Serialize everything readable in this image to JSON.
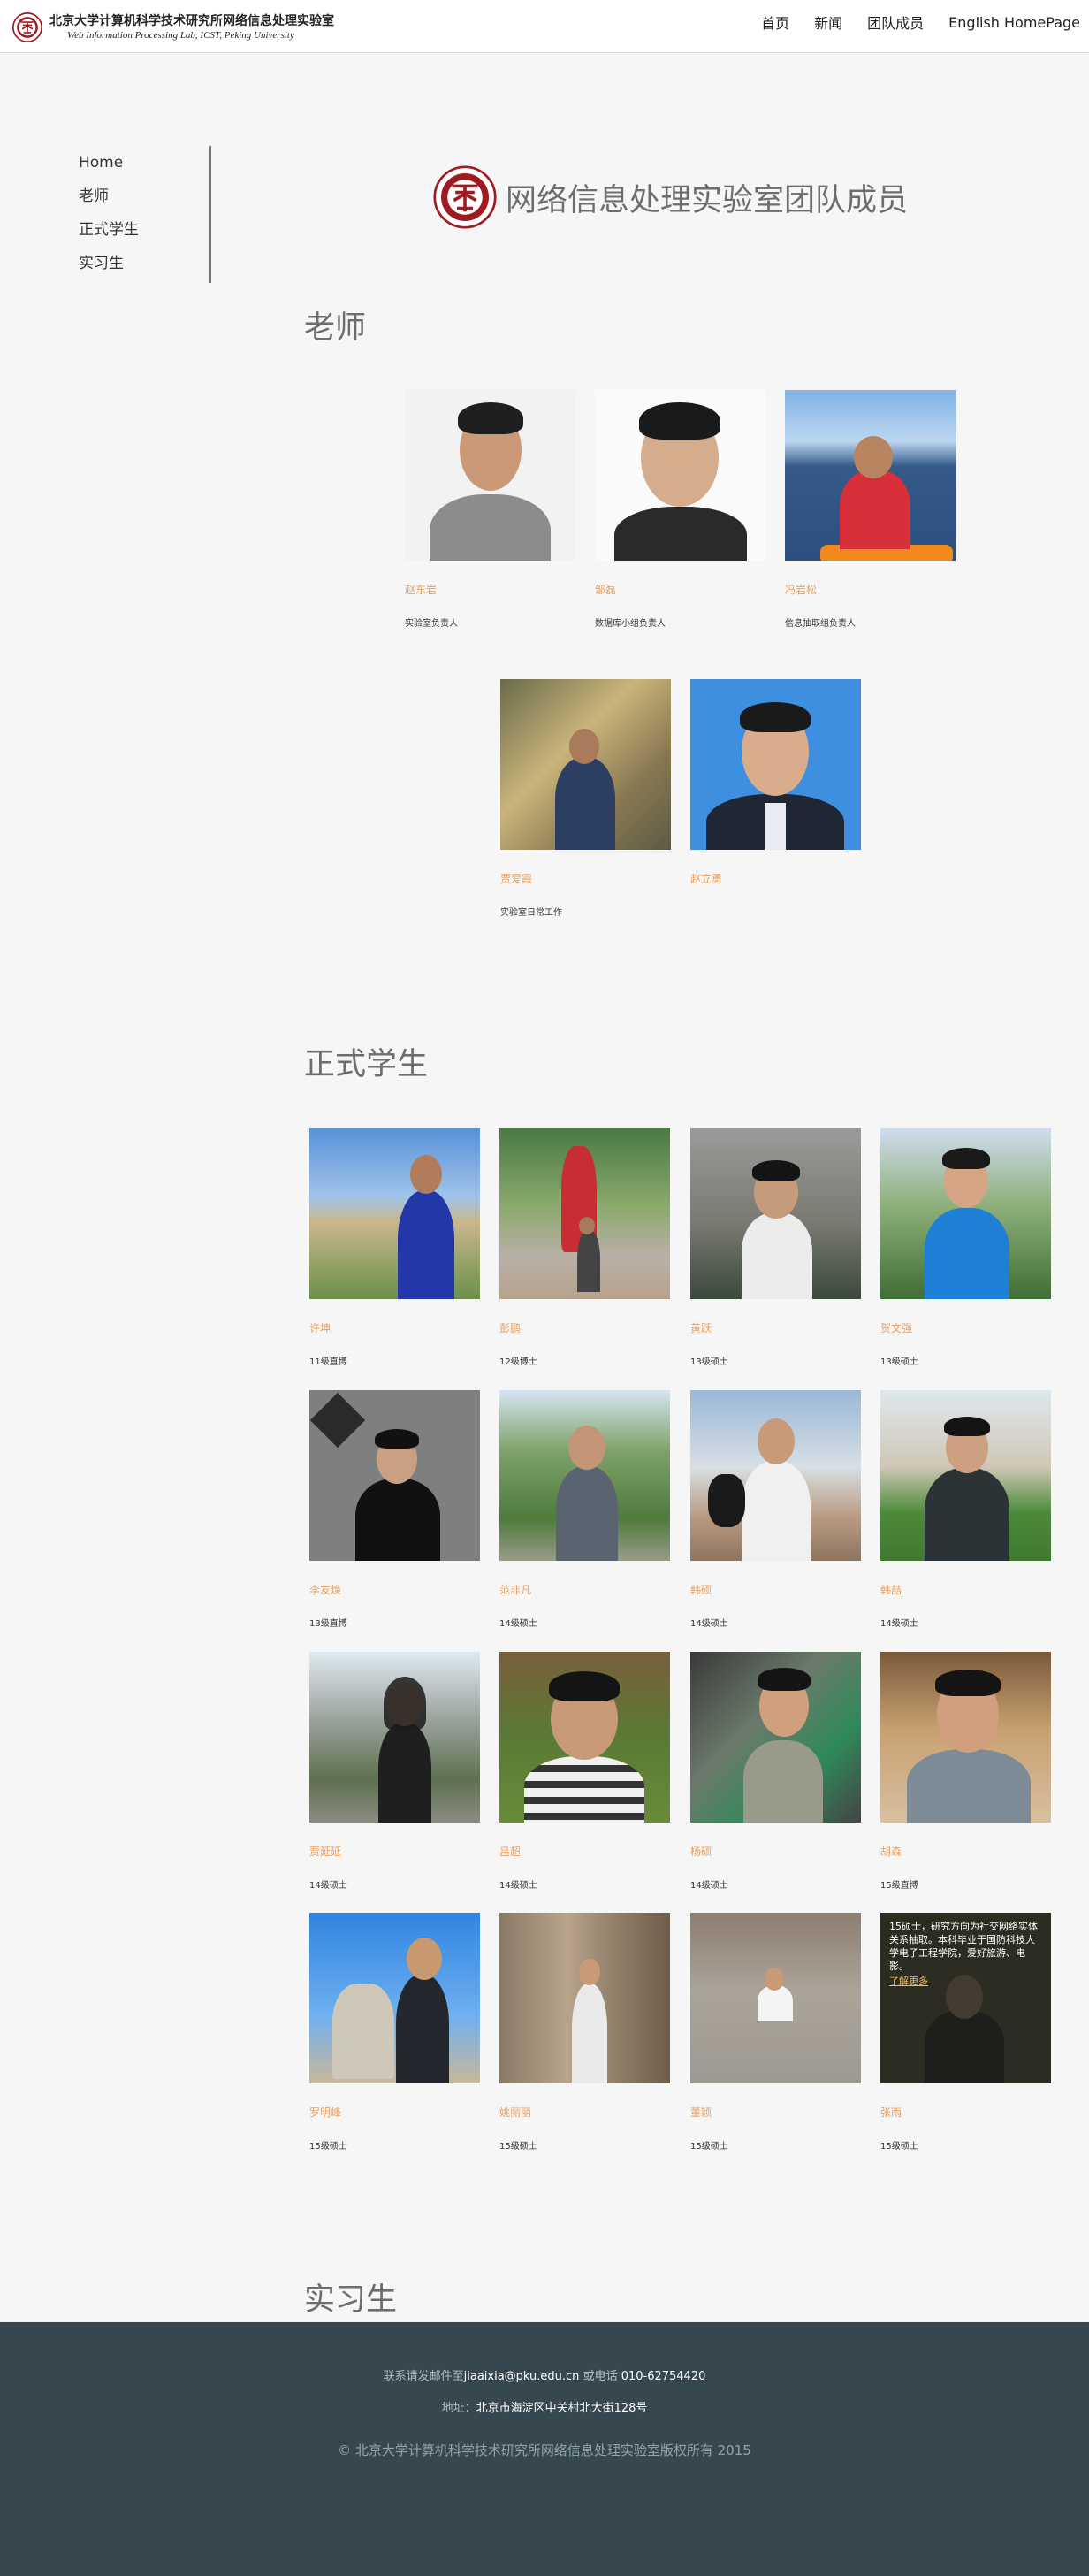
{
  "header": {
    "lab_name_cn": "北京大学计算机科学技术研究所网络信息处理实验室",
    "lab_name_en": "Web Information Processing Lab, ICST, Peking University",
    "logo_icon": "pku-seal-icon"
  },
  "nav": {
    "home": "首页",
    "news": "新闻",
    "team": "团队成员",
    "english": "English HomePage"
  },
  "sidenav": {
    "items": [
      "Home",
      "老师",
      "正式学生",
      "实习生"
    ]
  },
  "page_title": "网络信息处理实验室团队成员",
  "sections": {
    "teachers": "老师",
    "students": "正式学生",
    "interns": "实习生"
  },
  "teachers": [
    {
      "name": "赵东岩",
      "role": "实验室负责人"
    },
    {
      "name": "邹磊",
      "role": "数据库小组负责人"
    },
    {
      "name": "冯岩松",
      "role": "信息抽取组负责人"
    },
    {
      "name": "贾爱霞",
      "role": "实验室日常工作"
    },
    {
      "name": "赵立勇",
      "role": ""
    }
  ],
  "students": [
    {
      "name": "许坤",
      "role": "11级直博"
    },
    {
      "name": "彭鹏",
      "role": "12级博士"
    },
    {
      "name": "黄跃",
      "role": "13级硕士"
    },
    {
      "name": "贺文强",
      "role": "13级硕士"
    },
    {
      "name": "李友焕",
      "role": "13级直博"
    },
    {
      "name": "范非凡",
      "role": "14级硕士"
    },
    {
      "name": "韩硕",
      "role": "14级硕士"
    },
    {
      "name": "韩喆",
      "role": "14级硕士"
    },
    {
      "name": "贾延延",
      "role": "14级硕士"
    },
    {
      "name": "吕超",
      "role": "14级硕士"
    },
    {
      "name": "杨硕",
      "role": "14级硕士"
    },
    {
      "name": "胡森",
      "role": "15级直博"
    },
    {
      "name": "罗明峰",
      "role": "15级硕士"
    },
    {
      "name": "姚丽丽",
      "role": "15级硕士"
    },
    {
      "name": "董颖",
      "role": "15级硕士"
    },
    {
      "name": "张雨",
      "role": "15级硕士"
    }
  ],
  "hover_caption": {
    "text": "15硕士，研究方向为社交网络实体关系抽取。本科毕业于国防科技大学电子工程学院，爱好旅游、电影。",
    "more": "了解更多"
  },
  "footer": {
    "contact_prefix": "联系请发邮件至",
    "email": "jiaaixia@pku.edu.cn",
    "phone_prefix": " 或电话 ",
    "phone": "010-62754420",
    "address_prefix": "地址：",
    "address": "北京市海淀区中关村北大街128号",
    "copyright": "© 北京大学计算机科学技术研究所网络信息处理实验室版权所有 2015"
  }
}
